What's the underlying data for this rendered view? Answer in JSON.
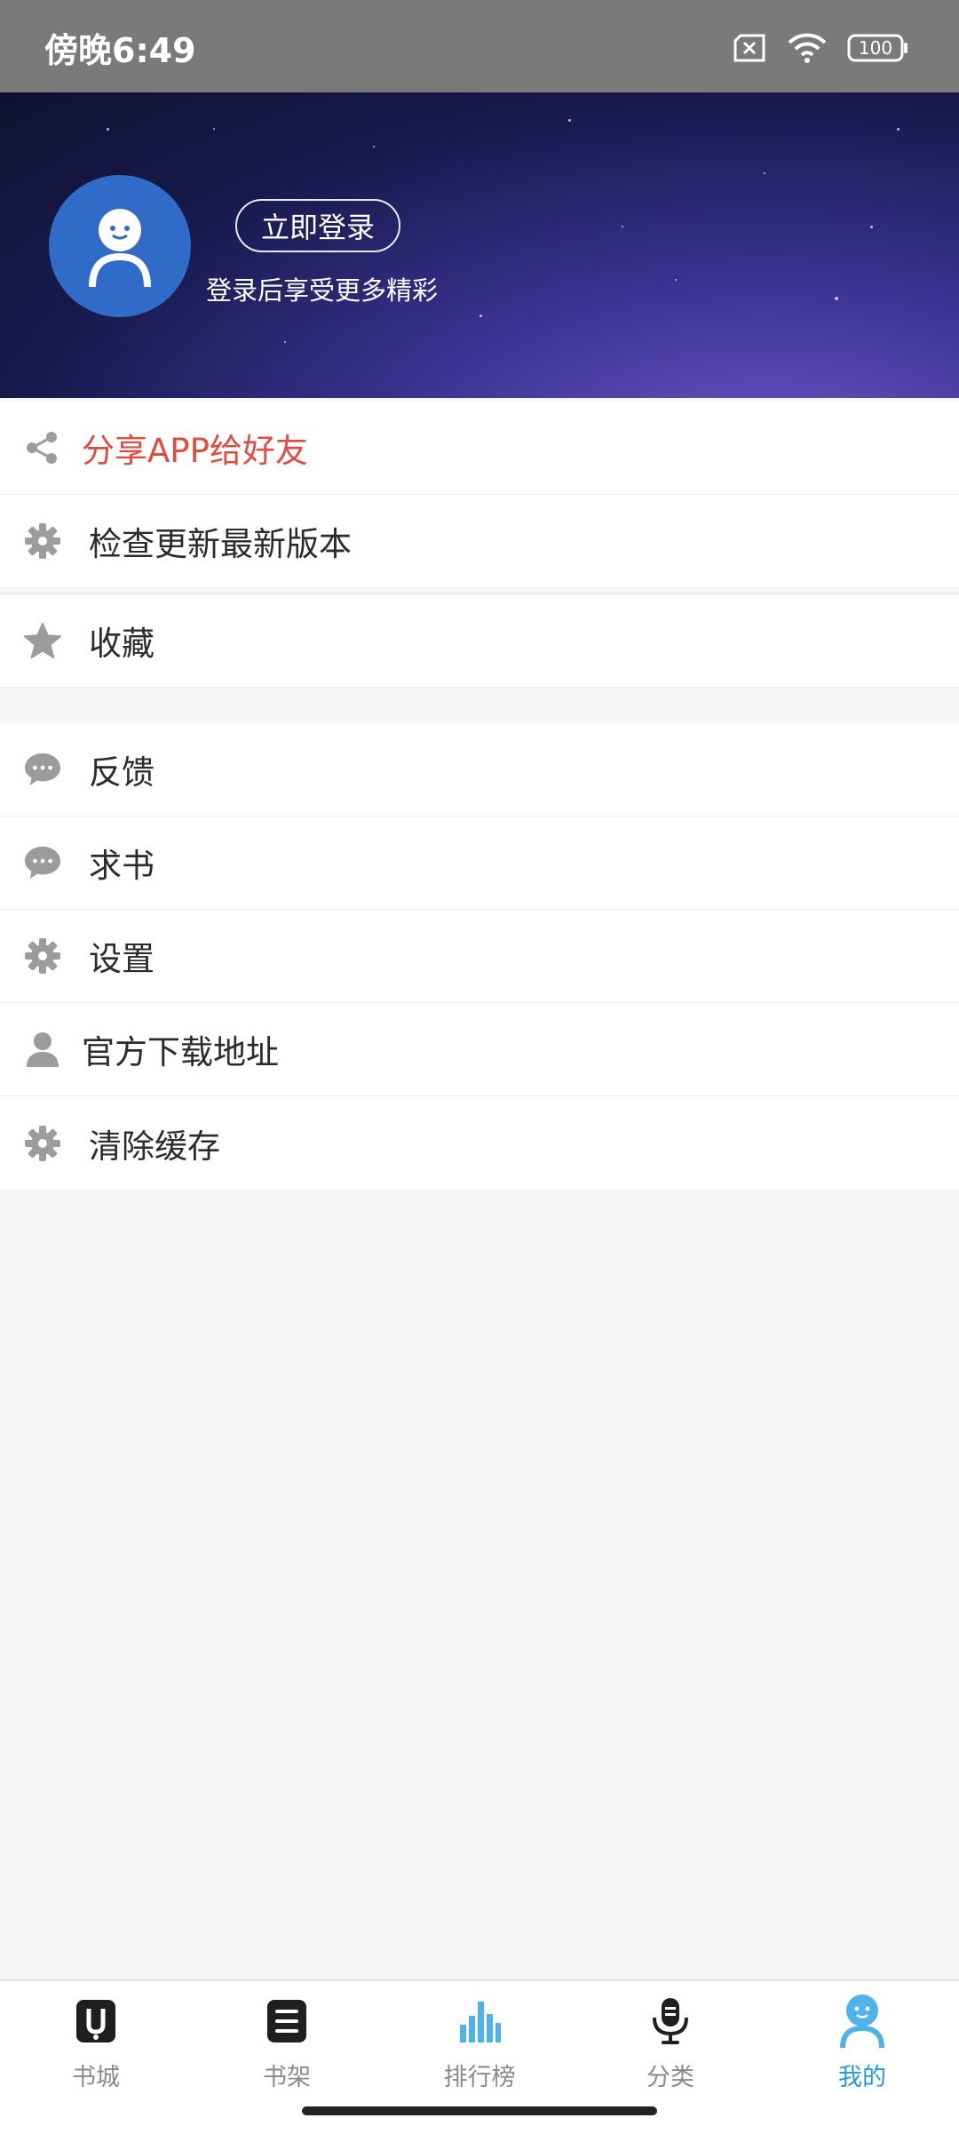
{
  "status_bar": {
    "time": "傍晚6:49",
    "battery": "100"
  },
  "header": {
    "login_label": "立即登录",
    "subtitle": "登录后享受更多精彩"
  },
  "menu_group_1": [
    {
      "label": "分享APP给好友",
      "icon": "share-icon"
    },
    {
      "label": "检查更新最新版本",
      "icon": "gear-icon"
    }
  ],
  "menu_group_2": [
    {
      "label": "收藏",
      "icon": "star-icon"
    }
  ],
  "menu_group_3": [
    {
      "label": "反馈",
      "icon": "chat-bubble-icon"
    },
    {
      "label": "求书",
      "icon": "chat-bubble-icon"
    },
    {
      "label": "设置",
      "icon": "gear-icon"
    },
    {
      "label": "官方下载地址",
      "icon": "person-icon"
    },
    {
      "label": "清除缓存",
      "icon": "gear-icon"
    }
  ],
  "bottom_nav": [
    {
      "label": "书城",
      "icon": "bookstore-icon"
    },
    {
      "label": "书架",
      "icon": "bookshelf-icon"
    },
    {
      "label": "排行榜",
      "icon": "ranking-icon"
    },
    {
      "label": "分类",
      "icon": "microphone-icon"
    },
    {
      "label": "我的",
      "icon": "profile-icon",
      "active": true
    }
  ],
  "colors": {
    "accent": "#1f9be6",
    "share_text": "#e24c3f",
    "avatar_bg": "#2f6bc7"
  }
}
